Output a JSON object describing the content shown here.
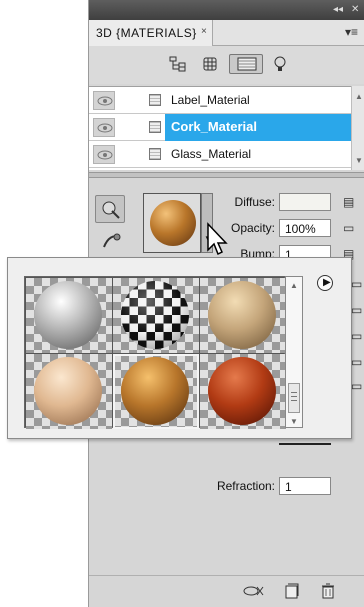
{
  "panel": {
    "title": "3D {MATERIALS}",
    "collapse_glyph": "◂◂",
    "close_glyph": "✕",
    "tab_close_glyph": "×",
    "menu_glyph": "▾≡"
  },
  "toolbar": {
    "icons": [
      "whole-scene-icon",
      "meshes-icon",
      "materials-icon",
      "lights-icon"
    ],
    "active": "materials-icon"
  },
  "materials": [
    {
      "name": "Label_Material",
      "selected": false
    },
    {
      "name": "Cork_Material",
      "selected": true
    },
    {
      "name": "Glass_Material",
      "selected": false
    }
  ],
  "properties": {
    "diffuse_label": "Diffuse:",
    "opacity_label": "Opacity:",
    "opacity_value": "100%",
    "bump_label": "Bump:",
    "bump_value": "1",
    "refraction_label": "Refraction:",
    "refraction_value": "1"
  },
  "picker": {
    "materials": [
      "metal",
      "checker",
      "stone",
      "skin",
      "cork",
      "leather"
    ],
    "selected": "cork"
  },
  "colors": {
    "selection": "#2aa7ea",
    "panel_bg": "#d6d6d6"
  }
}
